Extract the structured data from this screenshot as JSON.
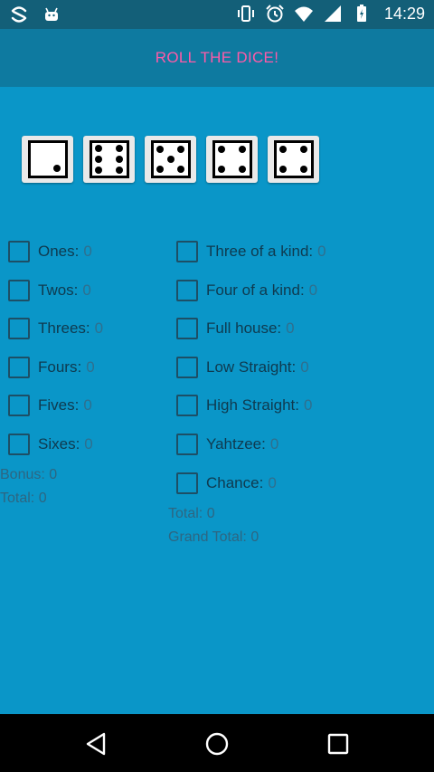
{
  "status_bar": {
    "time": "14:29",
    "icons": [
      "app-s-icon",
      "android-icon",
      "vibrate-icon",
      "alarm-icon",
      "wifi-icon",
      "signal-icon",
      "battery-icon"
    ]
  },
  "app_bar": {
    "title": "ROLL THE DICE!"
  },
  "dice": [
    1,
    6,
    5,
    4,
    4
  ],
  "upper": [
    {
      "label": "Ones:",
      "value": "0"
    },
    {
      "label": "Twos:",
      "value": "0"
    },
    {
      "label": "Threes:",
      "value": "0"
    },
    {
      "label": "Fours:",
      "value": "0"
    },
    {
      "label": "Fives:",
      "value": "0"
    },
    {
      "label": "Sixes:",
      "value": "0"
    }
  ],
  "upper_summary": {
    "bonus": "Bonus: 0",
    "total": "Total: 0"
  },
  "lower": [
    {
      "label": "Three of a kind:",
      "value": "0"
    },
    {
      "label": "Four of a kind:",
      "value": "0"
    },
    {
      "label": "Full house:",
      "value": "0"
    },
    {
      "label": "Low Straight:",
      "value": "0"
    },
    {
      "label": "High Straight:",
      "value": "0"
    },
    {
      "label": "Yahtzee:",
      "value": "0"
    },
    {
      "label": "Chance:",
      "value": "0"
    }
  ],
  "lower_summary": {
    "total": "Total: 0",
    "grand_total": "Grand Total: 0"
  },
  "nav": {
    "icons": [
      "back-icon",
      "home-icon",
      "recents-icon"
    ]
  },
  "colors": {
    "background": "#0a96c8",
    "appbar": "#0e7aa0",
    "title": "#ff5aa8"
  }
}
